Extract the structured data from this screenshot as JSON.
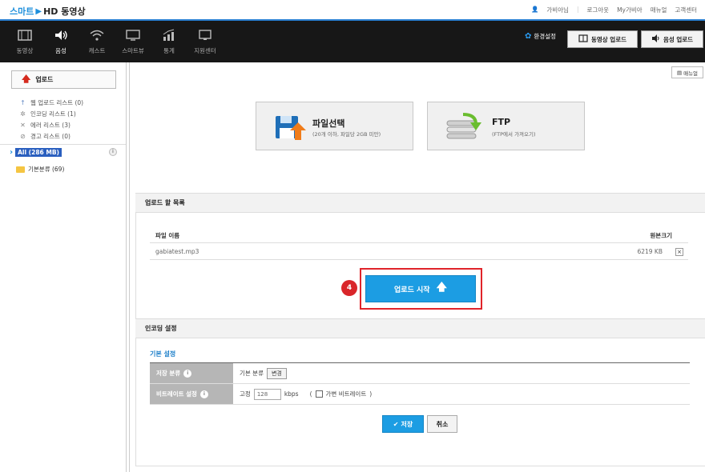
{
  "header": {
    "logo_prefix": "스마트",
    "logo_suffix": "HD 동영상",
    "user_name": "가비아님",
    "links": [
      "로그아웃",
      "My가비아",
      "매뉴얼",
      "고객센터"
    ]
  },
  "nav": {
    "items": [
      {
        "label": "동영상",
        "icon": "film-icon"
      },
      {
        "label": "음성",
        "icon": "speaker-icon"
      },
      {
        "label": "캐스트",
        "icon": "wifi-icon"
      },
      {
        "label": "스마트뷰",
        "icon": "monitor-icon"
      },
      {
        "label": "통계",
        "icon": "chart-icon"
      },
      {
        "label": "지원센터",
        "icon": "support-monitor-icon"
      }
    ],
    "active_index": 1,
    "env_setting": "환경설정",
    "video_upload": "동영상 업로드",
    "audio_upload": "음성 업로드"
  },
  "sidebar": {
    "upload_label": "업로드",
    "lists": [
      {
        "label": "웹 업로드 리스트 (0)",
        "icon": "up-arrow-icon"
      },
      {
        "label": "인코딩 리스트 (1)",
        "icon": "gear-icon"
      },
      {
        "label": "에러 리스트 (3)",
        "icon": "x-icon"
      },
      {
        "label": "경고 리스트 (0)",
        "icon": "warning-icon"
      }
    ],
    "all_label": "All (286 MB)",
    "folder_label": "기본분류 (69)"
  },
  "main": {
    "manual_label": "매뉴얼",
    "file_select": {
      "title": "파일선택",
      "sub": "(20개 이하, 파일당 2GB 미만)"
    },
    "ftp_select": {
      "title": "FTP",
      "sub": "(FTP에서 가져오기)"
    },
    "upload_list": {
      "title": "업로드 할 목록",
      "col_filename": "파일 이름",
      "col_size": "원본크기",
      "rows": [
        {
          "name": "gabiatest.mp3",
          "size": "6219 KB"
        }
      ]
    },
    "start_label": "업로드 시작",
    "step_number": "4",
    "encoding": {
      "title": "인코딩 설정",
      "basic_label": "기본 설정",
      "category_label": "저장 분류",
      "category_value": "기본 분류",
      "change_label": "변경",
      "bitrate_label": "비트레이트 설정",
      "fixed_label": "고정",
      "bitrate_value": "128",
      "bitrate_unit": "kbps",
      "paren_open": "(",
      "variable_label": "가변 비트레이트",
      "paren_close": ")"
    },
    "save_label": "저장",
    "cancel_label": "취소"
  },
  "colors": {
    "accent": "#1c9de3",
    "highlight_red": "#e0242a",
    "nav_bg": "#171717"
  }
}
